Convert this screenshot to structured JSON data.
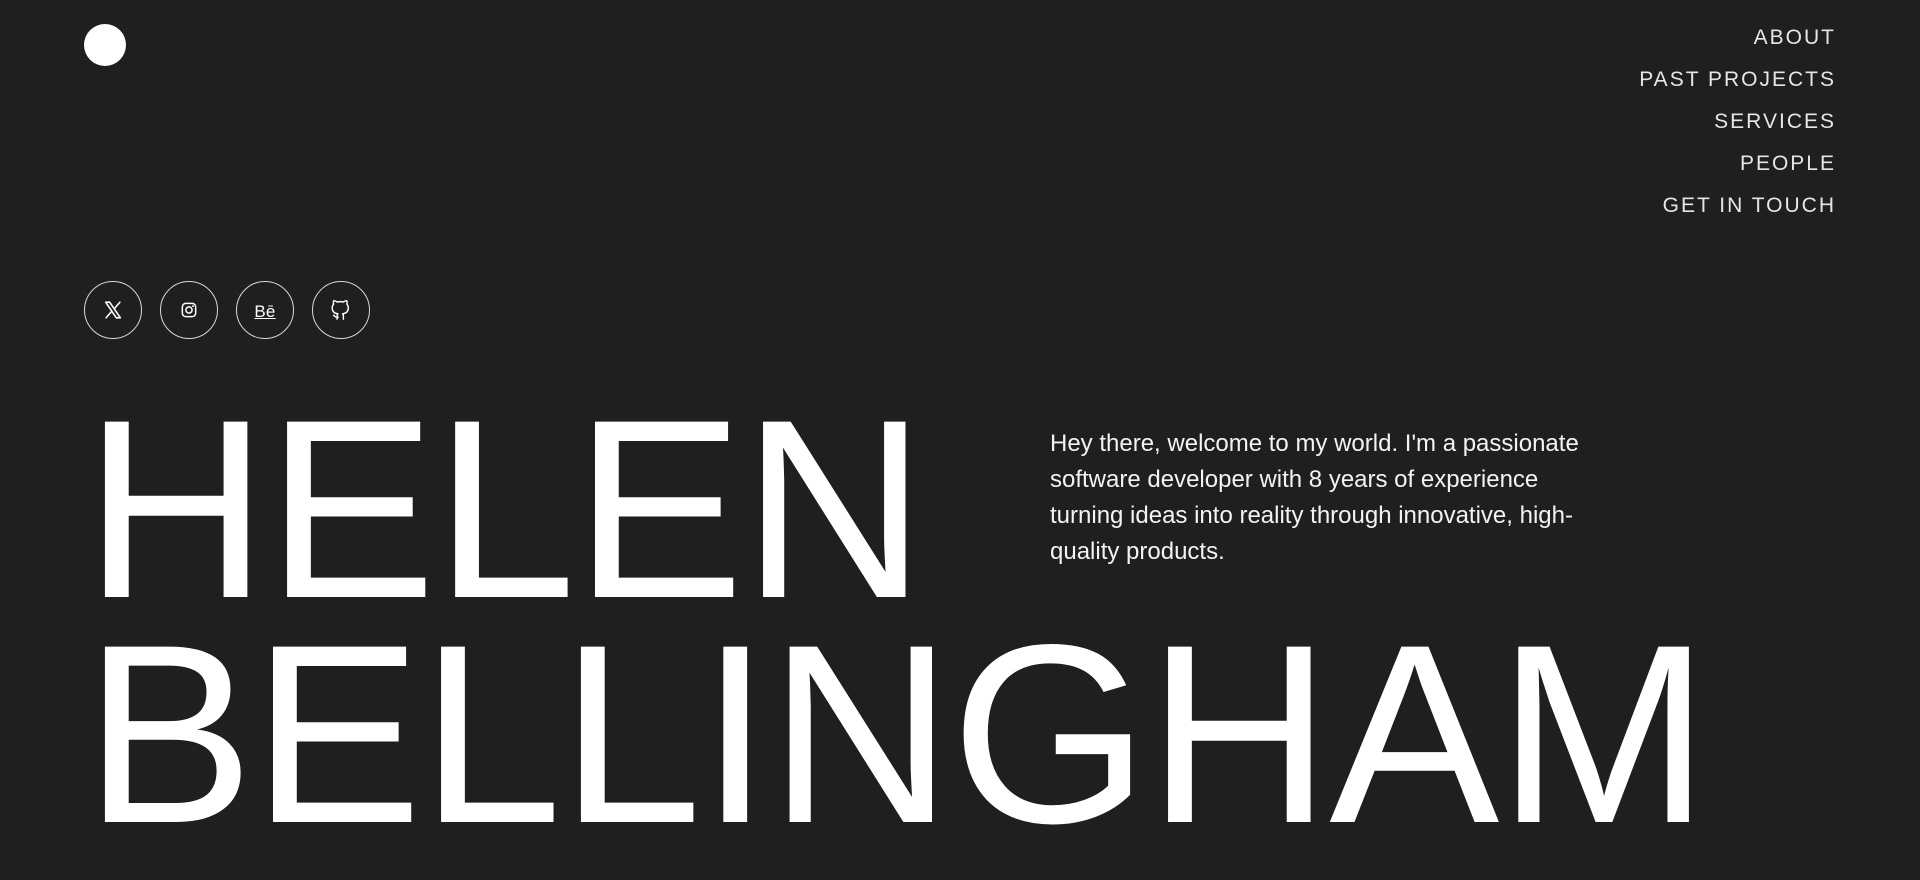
{
  "header": {
    "logo_icon": "circle-logo"
  },
  "nav": {
    "items": [
      "ABOUT",
      "PAST PROJECTS",
      "SERVICES",
      "PEOPLE",
      "GET IN TOUCH"
    ]
  },
  "socials": [
    {
      "name": "x-icon",
      "label": ""
    },
    {
      "name": "instagram-icon",
      "label": ""
    },
    {
      "name": "behance-icon",
      "label": "Bē"
    },
    {
      "name": "github-icon",
      "label": ""
    }
  ],
  "hero": {
    "first_name": "HELEN",
    "last_name": "BELLINGHAM",
    "intro": "Hey there, welcome to my world. I'm a passionate software developer with 8 years of experience turning ideas into reality through innovative, high-quality products."
  },
  "colors": {
    "background": "#1f1f1f",
    "text": "#ffffff",
    "nav_text": "#e6e6e6",
    "icon_border": "#d7d7d7"
  }
}
